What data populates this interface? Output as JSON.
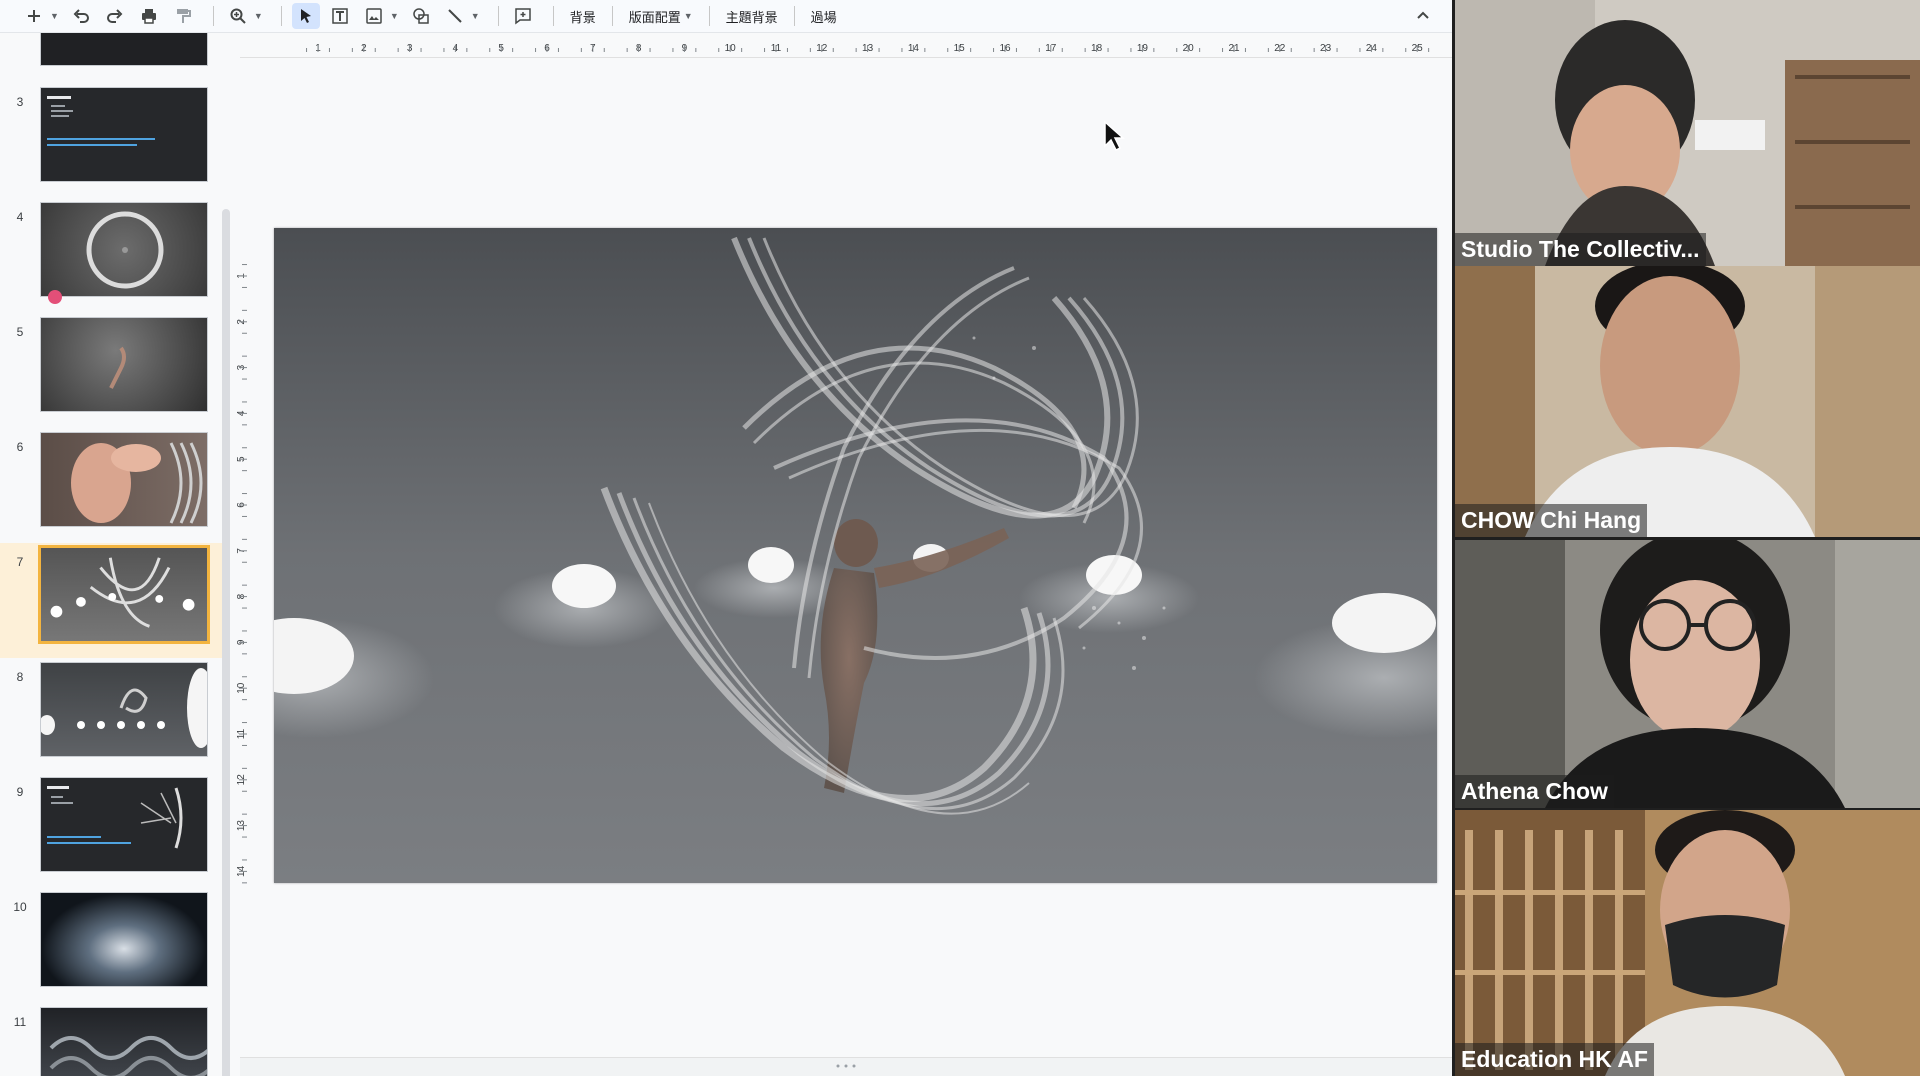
{
  "toolbar": {
    "background_label": "背景",
    "layout_label": "版面配置",
    "theme_label": "主題背景",
    "transition_label": "過場"
  },
  "ruler": {
    "horizontal_ticks": [
      "1",
      "2",
      "3",
      "4",
      "5",
      "6",
      "7",
      "8",
      "9",
      "10",
      "11",
      "12",
      "13",
      "14",
      "15",
      "16",
      "17",
      "18",
      "19",
      "20",
      "21",
      "22",
      "23",
      "24",
      "25"
    ],
    "vertical_ticks": [
      "1",
      "2",
      "3",
      "4",
      "5",
      "6",
      "7",
      "8",
      "9",
      "10",
      "11",
      "12",
      "13",
      "14"
    ]
  },
  "filmstrip": {
    "slides": [
      {
        "number": "3",
        "kind": "text-dark"
      },
      {
        "number": "4",
        "kind": "ring"
      },
      {
        "number": "5",
        "kind": "dark-figure"
      },
      {
        "number": "6",
        "kind": "skin-figure"
      },
      {
        "number": "7",
        "kind": "particles",
        "active": true
      },
      {
        "number": "8",
        "kind": "lights"
      },
      {
        "number": "9",
        "kind": "text-dark-2"
      },
      {
        "number": "10",
        "kind": "blue-glow"
      },
      {
        "number": "11",
        "kind": "tubes"
      }
    ]
  },
  "participants": [
    {
      "name": "Studio The Collectiv..."
    },
    {
      "name": "CHOW Chi Hang"
    },
    {
      "name": "Athena Chow"
    },
    {
      "name": "Education HK AF"
    }
  ],
  "colors": {
    "accent": "#f3b43f",
    "active_row": "#fdf0d8",
    "slide_bg": "#6b6e71",
    "toolbar_text": "#444746"
  }
}
